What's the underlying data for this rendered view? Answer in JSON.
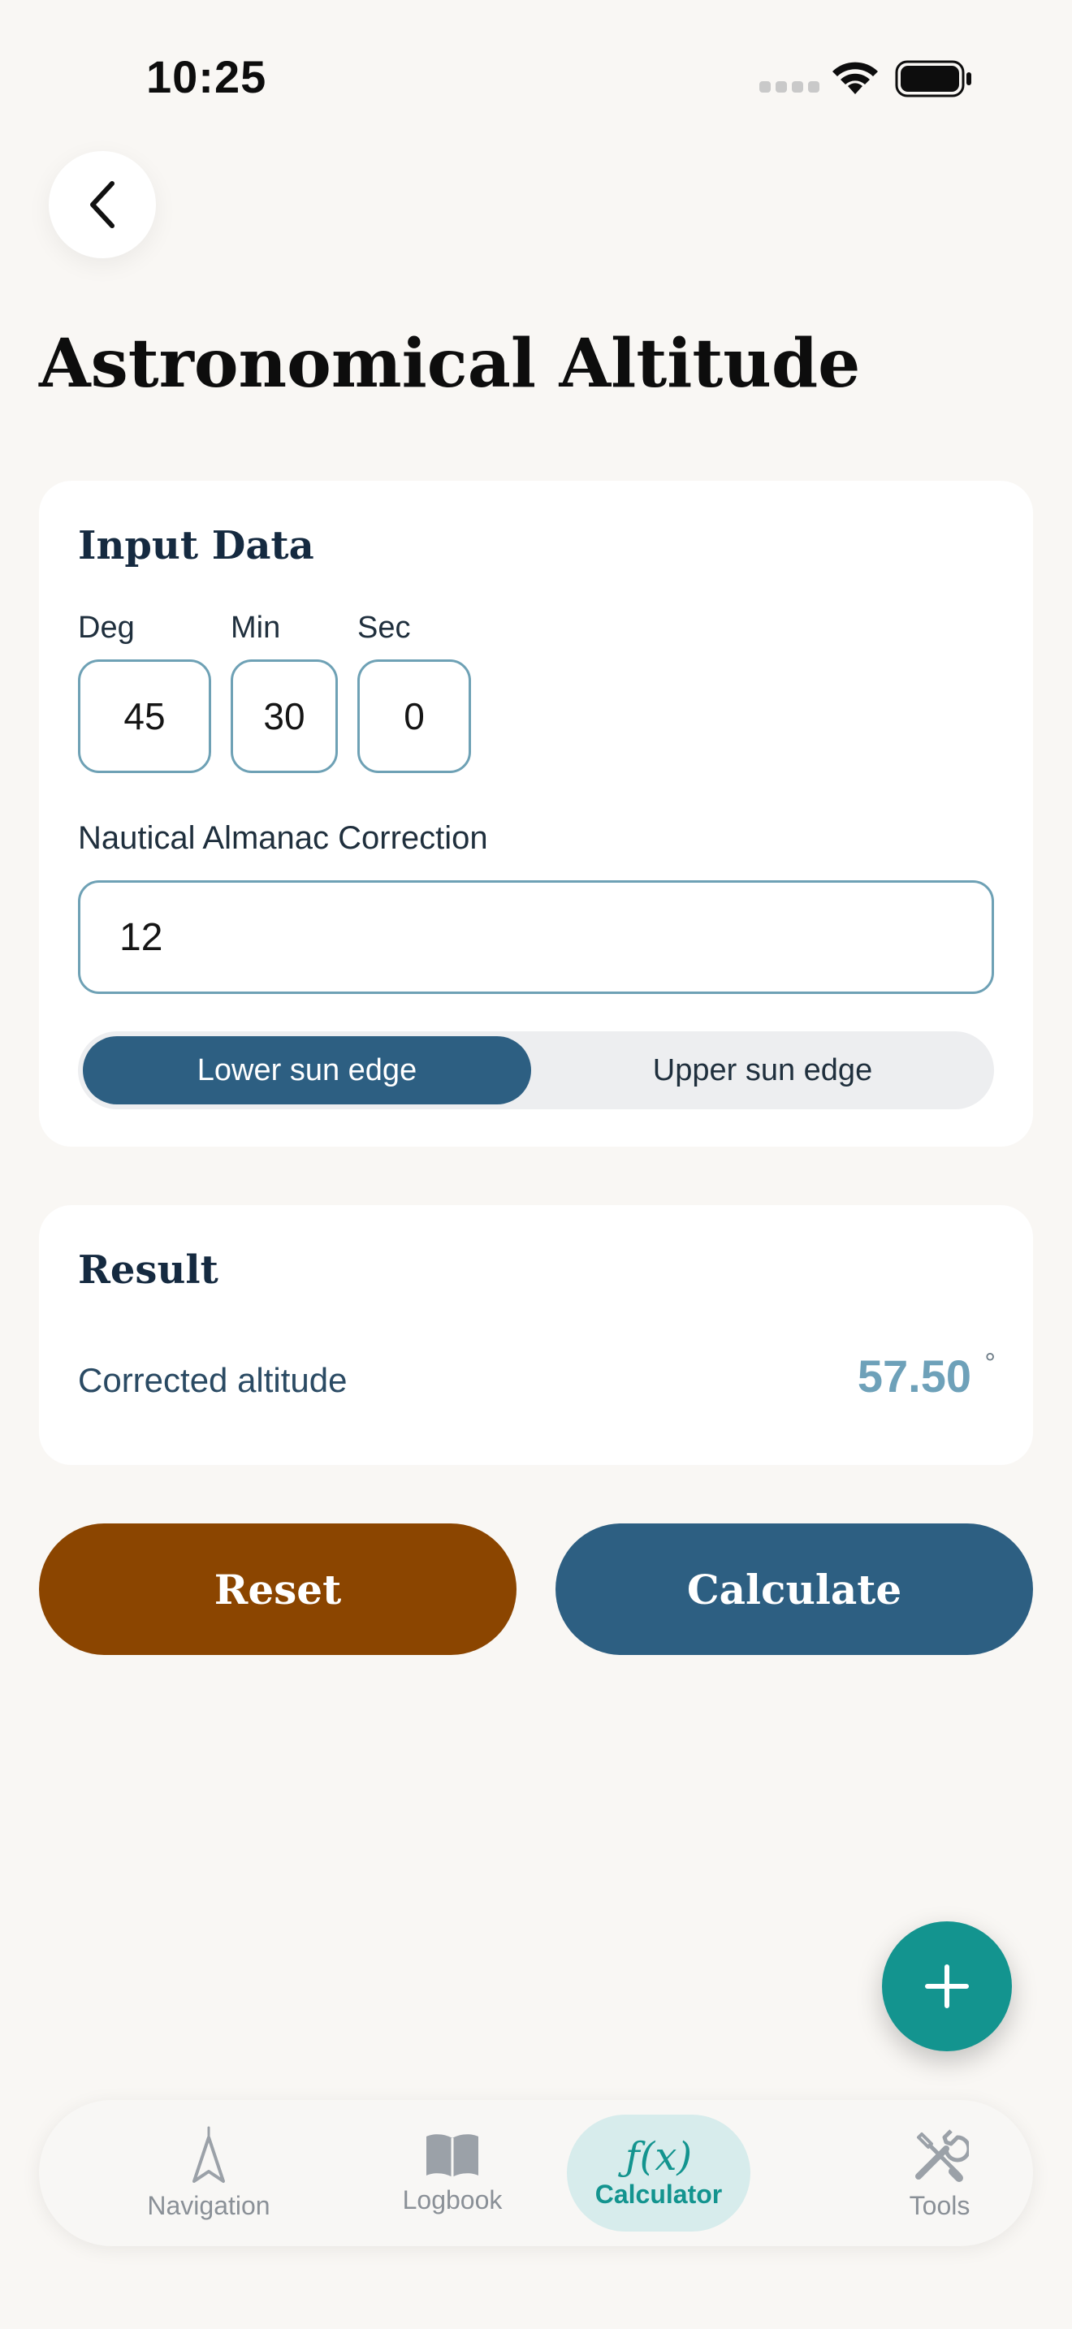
{
  "status_bar": {
    "time": "10:25"
  },
  "header": {
    "title": "Astronomical Altitude"
  },
  "input_card": {
    "title": "Input Data",
    "deg": {
      "label": "Deg",
      "value": "45"
    },
    "min": {
      "label": "Min",
      "value": "30"
    },
    "sec": {
      "label": "Sec",
      "value": "0"
    },
    "correction": {
      "label": "Nautical Almanac Correction",
      "value": "12"
    },
    "segments": [
      {
        "label": "Lower sun edge",
        "selected": true
      },
      {
        "label": "Upper sun edge",
        "selected": false
      }
    ]
  },
  "result_card": {
    "title": "Result",
    "row_label": "Corrected altitude",
    "value": "57.50",
    "unit": "°"
  },
  "actions": {
    "reset_label": "Reset",
    "calculate_label": "Calculate"
  },
  "tabs": [
    {
      "label": "Navigation",
      "icon": "navigation-arrow-icon"
    },
    {
      "label": "Logbook",
      "icon": "book-icon"
    },
    {
      "label": "Calculator",
      "icon": "function-icon",
      "glyph": "ƒ(x)",
      "active": true
    },
    {
      "label": "Tools",
      "icon": "tools-icon"
    }
  ],
  "colors": {
    "primary": "#2d5f82",
    "reset": "#8b4500",
    "accent": "#13948f",
    "result_value": "#6ea1b9"
  }
}
